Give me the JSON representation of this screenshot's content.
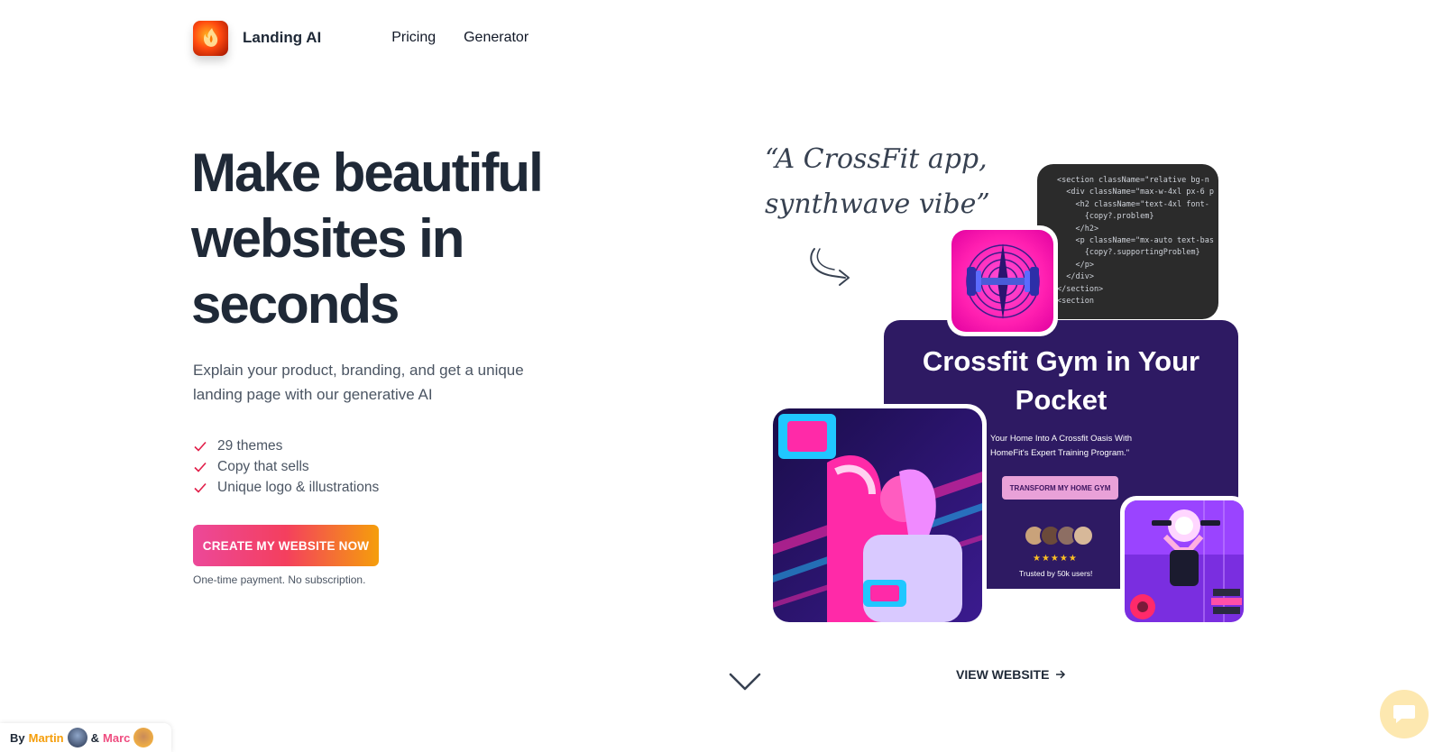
{
  "nav": {
    "brand": "Landing AI",
    "links": [
      "Pricing",
      "Generator"
    ]
  },
  "hero": {
    "title": "Make beautiful websites in seconds",
    "subtitle": "Explain your product, branding, and get a unique landing page with our generative AI",
    "features": [
      "29 themes",
      "Copy that sells",
      "Unique logo & illustrations"
    ],
    "cta_label": "CREATE MY WEBSITE NOW",
    "cta_note": "One-time payment. No subscription."
  },
  "showcase": {
    "quote_line1": "“A CrossFit app,",
    "quote_line2": "synthwave vibe”",
    "code_lines": [
      "<section className=\"relative bg-n",
      "  <div className=\"max-w-4xl px-6 p",
      "    <h2 className=\"text-4xl font-",
      "      {copy?.problem}",
      "    </h2>",
      "    <p className=\"mx-auto text-bas",
      "      {copy?.supportingProblem}",
      "    </p>",
      "  </div>",
      "</section>",
      "",
      "<section"
    ],
    "site_title": "Crossfit Gym in Your Pocket",
    "site_desc": "Your Home Into A Crossfit Oasis With HomeFit's Expert Training Program.\"",
    "site_button": "TRANSFORM MY HOME GYM",
    "site_stars": "★★★★★",
    "site_trusted": "Trusted by 50k users!",
    "view_link": "VIEW WEBSITE"
  },
  "byline": {
    "by": "By",
    "author1": "Martin",
    "amp": "&",
    "author2": "Marc"
  },
  "colors": {
    "accent_pink": "#ec4899",
    "accent_orange": "#f59e0b",
    "site_bg": "#2e1a63",
    "check_red": "#e11d48"
  },
  "icons": {
    "logo": "flame-icon",
    "check": "check-icon",
    "arrow": "curved-arrow-icon",
    "chevron": "chevron-down-icon",
    "view_arrow": "arrow-right-icon",
    "chat": "chat-icon"
  }
}
